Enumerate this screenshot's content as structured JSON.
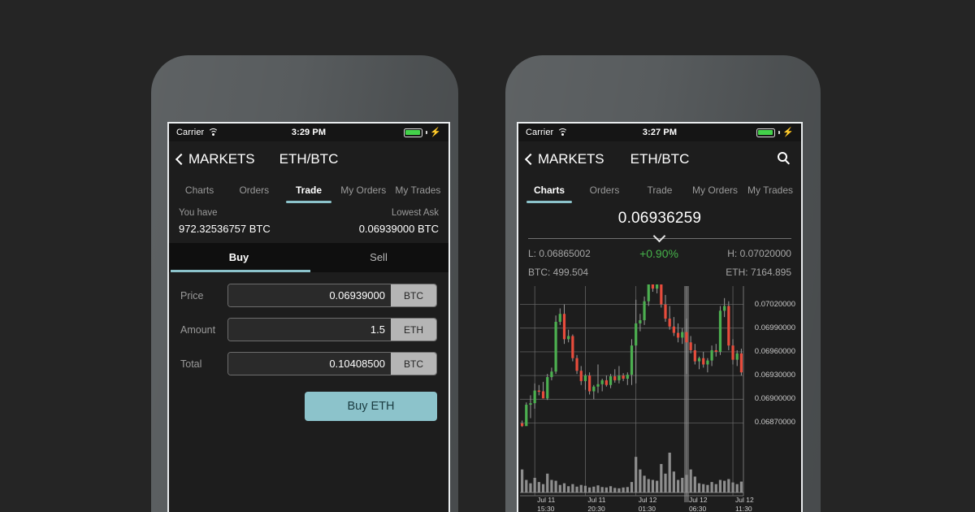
{
  "background_color": "#252525",
  "accent_color": "#8cc3cb",
  "up_color": "#4caf50",
  "down_color": "#e74c3c",
  "positive_color": "#46b24a",
  "phones": {
    "left": {
      "status": {
        "carrier": "Carrier",
        "time": "3:29 PM",
        "wifi_icon": "wifi-icon",
        "battery_icon": "battery-icon",
        "charging_icon": "bolt-icon"
      },
      "nav": {
        "back_label": "MARKETS",
        "back_icon": "chevron-left-icon",
        "title": "ETH/BTC"
      },
      "tabs": [
        {
          "label": "Charts",
          "active": false
        },
        {
          "label": "Orders",
          "active": false
        },
        {
          "label": "Trade",
          "active": true
        },
        {
          "label": "My Orders",
          "active": false
        },
        {
          "label": "My Trades",
          "active": false
        }
      ],
      "balance": {
        "you_have_label": "You have",
        "you_have_value": "972.32536757 BTC",
        "lowest_ask_label": "Lowest Ask",
        "lowest_ask_value": "0.06939000 BTC"
      },
      "side_tabs": [
        {
          "label": "Buy",
          "active": true
        },
        {
          "label": "Sell",
          "active": false
        }
      ],
      "fields": [
        {
          "label": "Price",
          "value": "0.06939000",
          "unit": "BTC"
        },
        {
          "label": "Amount",
          "value": "1.5",
          "unit": "ETH"
        },
        {
          "label": "Total",
          "value": "0.10408500",
          "unit": "BTC"
        }
      ],
      "submit_label": "Buy ETH"
    },
    "right": {
      "status": {
        "carrier": "Carrier",
        "time": "3:27 PM",
        "wifi_icon": "wifi-icon",
        "battery_icon": "battery-icon",
        "charging_icon": "bolt-icon"
      },
      "nav": {
        "back_label": "MARKETS",
        "back_icon": "chevron-left-icon",
        "title": "ETH/BTC",
        "search_icon": "search-icon"
      },
      "tabs": [
        {
          "label": "Charts",
          "active": true
        },
        {
          "label": "Orders",
          "active": false
        },
        {
          "label": "Trade",
          "active": false
        },
        {
          "label": "My Orders",
          "active": false
        },
        {
          "label": "My Trades",
          "active": false
        }
      ],
      "summary": {
        "last_price": "0.06936259",
        "expand_icon": "chevron-down-icon",
        "low": "L: 0.06865002",
        "change": "+0.90%",
        "high": "H: 0.07020000",
        "btc_volume": "BTC: 499.504",
        "eth_volume": "ETH: 7164.895"
      }
    }
  },
  "chart_data": {
    "type": "candlestick",
    "title": "ETH/BTC",
    "xlabel": "",
    "ylabel": "",
    "grid": true,
    "ylim": [
      0.06855,
      0.07035
    ],
    "y_ticks": [
      "0.07020000",
      "0.06990000",
      "0.06960000",
      "0.06930000",
      "0.06900000",
      "0.06870000"
    ],
    "y_tick_values": [
      0.0702,
      0.0699,
      0.0696,
      0.0693,
      0.069,
      0.0687
    ],
    "x_ticks": [
      {
        "date": "Jul 11",
        "time": "15:30"
      },
      {
        "date": "Jul 11",
        "time": "20:30"
      },
      {
        "date": "Jul 12",
        "time": "01:30"
      },
      {
        "date": "Jul 12",
        "time": "06:30"
      },
      {
        "date": "Jul 12",
        "time": "11:30"
      }
    ],
    "crosshair_x_index": 39,
    "candles": [
      {
        "o": 0.068695,
        "h": 0.06873,
        "l": 0.06865,
        "c": 0.06866,
        "v": 0.55
      },
      {
        "o": 0.06866,
        "h": 0.06896,
        "l": 0.0687,
        "c": 0.06893,
        "v": 0.3
      },
      {
        "o": 0.06893,
        "h": 0.06905,
        "l": 0.06876,
        "c": 0.06895,
        "v": 0.22
      },
      {
        "o": 0.06895,
        "h": 0.0692,
        "l": 0.06888,
        "c": 0.06911,
        "v": 0.35
      },
      {
        "o": 0.06911,
        "h": 0.06918,
        "l": 0.06905,
        "c": 0.0691,
        "v": 0.25
      },
      {
        "o": 0.0691,
        "h": 0.06922,
        "l": 0.06904,
        "c": 0.06901,
        "v": 0.2
      },
      {
        "o": 0.06901,
        "h": 0.06932,
        "l": 0.06899,
        "c": 0.06928,
        "v": 0.45
      },
      {
        "o": 0.06928,
        "h": 0.0694,
        "l": 0.06924,
        "c": 0.06935,
        "v": 0.3
      },
      {
        "o": 0.06935,
        "h": 0.07006,
        "l": 0.06932,
        "c": 0.06998,
        "v": 0.28
      },
      {
        "o": 0.06998,
        "h": 0.07015,
        "l": 0.06994,
        "c": 0.07008,
        "v": 0.18
      },
      {
        "o": 0.07008,
        "h": 0.0702,
        "l": 0.0697,
        "c": 0.06976,
        "v": 0.22
      },
      {
        "o": 0.06976,
        "h": 0.06988,
        "l": 0.06972,
        "c": 0.0698,
        "v": 0.15
      },
      {
        "o": 0.0698,
        "h": 0.06982,
        "l": 0.06948,
        "c": 0.06952,
        "v": 0.2
      },
      {
        "o": 0.06952,
        "h": 0.06956,
        "l": 0.06932,
        "c": 0.06936,
        "v": 0.14
      },
      {
        "o": 0.06936,
        "h": 0.06942,
        "l": 0.06918,
        "c": 0.06923,
        "v": 0.18
      },
      {
        "o": 0.06923,
        "h": 0.06932,
        "l": 0.06912,
        "c": 0.0693,
        "v": 0.16
      },
      {
        "o": 0.0693,
        "h": 0.06934,
        "l": 0.06906,
        "c": 0.0691,
        "v": 0.12
      },
      {
        "o": 0.0691,
        "h": 0.06918,
        "l": 0.069,
        "c": 0.06916,
        "v": 0.14
      },
      {
        "o": 0.06916,
        "h": 0.06944,
        "l": 0.06908,
        "c": 0.06919,
        "v": 0.17
      },
      {
        "o": 0.06919,
        "h": 0.06926,
        "l": 0.0691,
        "c": 0.06924,
        "v": 0.13
      },
      {
        "o": 0.06924,
        "h": 0.0693,
        "l": 0.06916,
        "c": 0.06918,
        "v": 0.12
      },
      {
        "o": 0.06918,
        "h": 0.06932,
        "l": 0.06914,
        "c": 0.06929,
        "v": 0.15
      },
      {
        "o": 0.06929,
        "h": 0.06938,
        "l": 0.06921,
        "c": 0.06924,
        "v": 0.11
      },
      {
        "o": 0.06924,
        "h": 0.06942,
        "l": 0.0692,
        "c": 0.0693,
        "v": 0.1
      },
      {
        "o": 0.0693,
        "h": 0.06933,
        "l": 0.06923,
        "c": 0.06926,
        "v": 0.12
      },
      {
        "o": 0.06926,
        "h": 0.06934,
        "l": 0.06918,
        "c": 0.06931,
        "v": 0.13
      },
      {
        "o": 0.06931,
        "h": 0.06976,
        "l": 0.06918,
        "c": 0.06968,
        "v": 0.25
      },
      {
        "o": 0.06968,
        "h": 0.07026,
        "l": 0.0692,
        "c": 0.06996,
        "v": 0.85
      },
      {
        "o": 0.06996,
        "h": 0.07008,
        "l": 0.06986,
        "c": 0.07,
        "v": 0.55
      },
      {
        "o": 0.07,
        "h": 0.0703,
        "l": 0.06994,
        "c": 0.07024,
        "v": 0.4
      },
      {
        "o": 0.07024,
        "h": 0.07052,
        "l": 0.07018,
        "c": 0.07048,
        "v": 0.32
      },
      {
        "o": 0.07048,
        "h": 0.0706,
        "l": 0.07036,
        "c": 0.0704,
        "v": 0.3
      },
      {
        "o": 0.0704,
        "h": 0.07058,
        "l": 0.07034,
        "c": 0.07052,
        "v": 0.28
      },
      {
        "o": 0.07052,
        "h": 0.07062,
        "l": 0.07016,
        "c": 0.0702,
        "v": 0.68
      },
      {
        "o": 0.0702,
        "h": 0.07032,
        "l": 0.06998,
        "c": 0.07002,
        "v": 0.45
      },
      {
        "o": 0.07002,
        "h": 0.07018,
        "l": 0.06988,
        "c": 0.06992,
        "v": 0.95
      },
      {
        "o": 0.06992,
        "h": 0.07004,
        "l": 0.0698,
        "c": 0.06984,
        "v": 0.5
      },
      {
        "o": 0.06984,
        "h": 0.06996,
        "l": 0.06972,
        "c": 0.06978,
        "v": 0.3
      },
      {
        "o": 0.06978,
        "h": 0.0699,
        "l": 0.0697,
        "c": 0.06985,
        "v": 0.35
      },
      {
        "o": 0.06985,
        "h": 0.07002,
        "l": 0.06932,
        "c": 0.06972,
        "v": 0.42
      },
      {
        "o": 0.06972,
        "h": 0.0698,
        "l": 0.06958,
        "c": 0.06962,
        "v": 0.55
      },
      {
        "o": 0.06962,
        "h": 0.0697,
        "l": 0.06944,
        "c": 0.06948,
        "v": 0.38
      },
      {
        "o": 0.06948,
        "h": 0.06954,
        "l": 0.06938,
        "c": 0.06952,
        "v": 0.22
      },
      {
        "o": 0.06952,
        "h": 0.0696,
        "l": 0.0694,
        "c": 0.06944,
        "v": 0.2
      },
      {
        "o": 0.06944,
        "h": 0.06952,
        "l": 0.06934,
        "c": 0.06949,
        "v": 0.18
      },
      {
        "o": 0.06949,
        "h": 0.06968,
        "l": 0.06942,
        "c": 0.06962,
        "v": 0.25
      },
      {
        "o": 0.06962,
        "h": 0.0697,
        "l": 0.06954,
        "c": 0.0696,
        "v": 0.2
      },
      {
        "o": 0.0696,
        "h": 0.07018,
        "l": 0.06956,
        "c": 0.07012,
        "v": 0.3
      },
      {
        "o": 0.07012,
        "h": 0.07028,
        "l": 0.07004,
        "c": 0.07018,
        "v": 0.28
      },
      {
        "o": 0.07018,
        "h": 0.07024,
        "l": 0.06962,
        "c": 0.06968,
        "v": 0.32
      },
      {
        "o": 0.06968,
        "h": 0.06976,
        "l": 0.06944,
        "c": 0.0695,
        "v": 0.24
      },
      {
        "o": 0.0695,
        "h": 0.06962,
        "l": 0.06942,
        "c": 0.06958,
        "v": 0.2
      },
      {
        "o": 0.06958,
        "h": 0.06964,
        "l": 0.0693,
        "c": 0.06934,
        "v": 0.26
      }
    ]
  }
}
